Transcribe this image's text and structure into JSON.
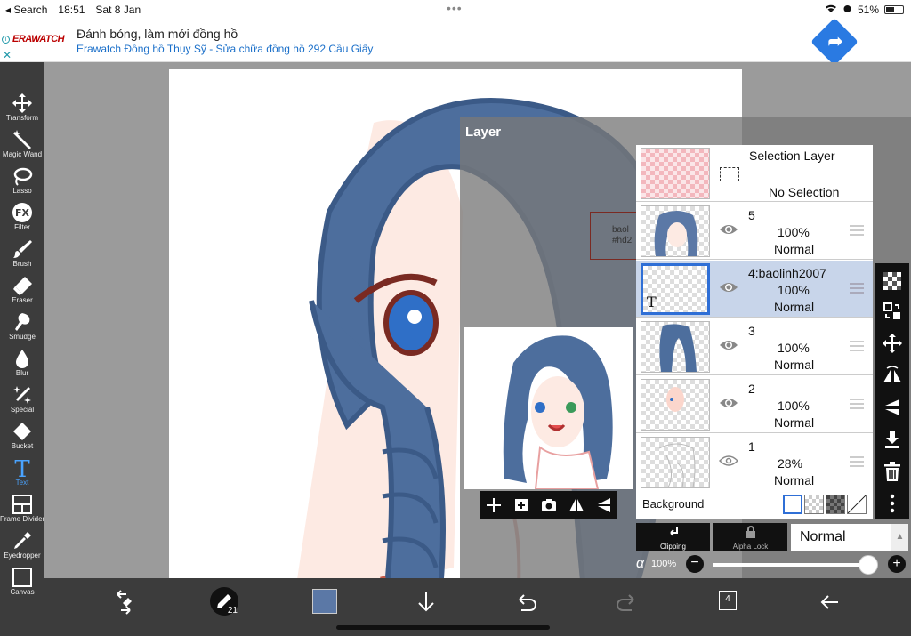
{
  "status": {
    "back_app": "◂ Search",
    "time": "18:51",
    "date": "Sat 8 Jan",
    "battery": "51%"
  },
  "ad": {
    "brand": "ERAWATCH",
    "title": "Đánh bóng, làm mới đồng hồ",
    "subtitle": "Erawatch Đồng hồ Thụy Sỹ - Sửa chữa đồng hồ 292 Cầu Giấy"
  },
  "tools": [
    {
      "label": "Transform",
      "icon": "move-arrows-icon"
    },
    {
      "label": "Magic Wand",
      "icon": "magic-wand-icon"
    },
    {
      "label": "Lasso",
      "icon": "lasso-icon"
    },
    {
      "label": "Filter",
      "icon": "fx-icon"
    },
    {
      "label": "Brush",
      "icon": "brush-icon"
    },
    {
      "label": "Eraser",
      "icon": "eraser-icon"
    },
    {
      "label": "Smudge",
      "icon": "smudge-icon"
    },
    {
      "label": "Blur",
      "icon": "droplet-icon"
    },
    {
      "label": "Special",
      "icon": "sparkle-icon"
    },
    {
      "label": "Bucket",
      "icon": "bucket-icon"
    },
    {
      "label": "Text",
      "icon": "text-icon",
      "active": true
    },
    {
      "label": "Frame Divider",
      "icon": "frame-divider-icon"
    },
    {
      "label": "Eyedropper",
      "icon": "eyedropper-icon"
    },
    {
      "label": "Canvas",
      "icon": "canvas-icon"
    }
  ],
  "layer_panel": {
    "title": "Layer",
    "selection_layer": {
      "title": "Selection Layer",
      "subtitle": "No Selection"
    },
    "layers": [
      {
        "name": "5",
        "opacity": "100%",
        "mode": "Normal",
        "selected": false
      },
      {
        "name": "4:baolinh2007",
        "opacity": "100%",
        "mode": "Normal",
        "selected": true
      },
      {
        "name": "3",
        "opacity": "100%",
        "mode": "Normal",
        "selected": false
      },
      {
        "name": "2",
        "opacity": "100%",
        "mode": "Normal",
        "selected": false
      },
      {
        "name": "1",
        "opacity": "28%",
        "mode": "Normal",
        "selected": false
      }
    ],
    "background_label": "Background",
    "clipping_label": "Clipping",
    "alpha_lock_label": "Alpha Lock",
    "blend_mode": "Normal",
    "alpha_symbol": "α",
    "alpha_value": "100%",
    "alpha_fraction": 1.0,
    "text_layer_glyph": "T"
  },
  "canvas_text": "baol\n#hd2",
  "bottom": {
    "brush_size": "21",
    "color": "#5b78a6",
    "layer_count": "4"
  }
}
